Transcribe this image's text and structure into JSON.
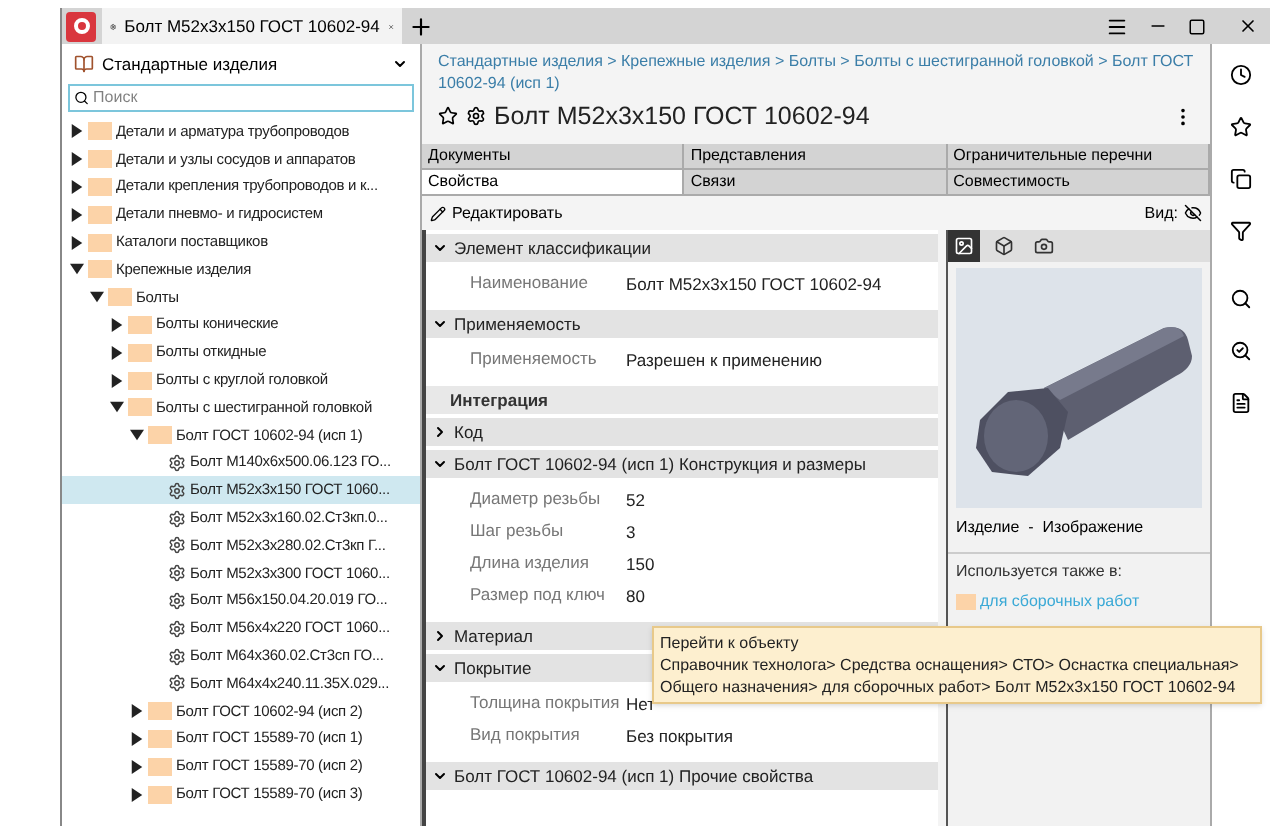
{
  "app": {
    "tab_title": "Болт М52x3x150 ГОСТ 10602-94"
  },
  "library": {
    "name": "Стандартные изделия",
    "search_placeholder": "Поиск"
  },
  "tree": [
    {
      "label": "Детали и арматура трубопроводов",
      "kind": "folder",
      "expanded": false,
      "selected": false
    },
    {
      "label": "Детали и узлы сосудов и аппаратов",
      "kind": "folder",
      "expanded": false,
      "selected": false
    },
    {
      "label": "Детали крепления трубопроводов и к...",
      "kind": "folder",
      "expanded": false,
      "selected": false
    },
    {
      "label": "Детали пневмо- и гидросистем",
      "kind": "folder",
      "expanded": false,
      "selected": false
    },
    {
      "label": "Каталоги поставщиков",
      "kind": "folder",
      "expanded": false,
      "selected": false
    },
    {
      "label": "Крепежные изделия",
      "kind": "folder",
      "expanded": true,
      "selected": false,
      "children": [
        {
          "label": "Болты",
          "kind": "folder",
          "expanded": true,
          "selected": false,
          "children": [
            {
              "label": "Болты конические",
              "kind": "folder",
              "expanded": false,
              "selected": false
            },
            {
              "label": "Болты откидные",
              "kind": "folder",
              "expanded": false,
              "selected": false
            },
            {
              "label": "Болты с круглой головкой",
              "kind": "folder",
              "expanded": false,
              "selected": false
            },
            {
              "label": "Болты с шестигранной головкой",
              "kind": "folder",
              "expanded": true,
              "selected": false,
              "children": [
                {
                  "label": "Болт ГОСТ 10602-94 (исп 1)",
                  "kind": "folder",
                  "expanded": true,
                  "selected": false,
                  "children": [
                    {
                      "label": "Болт М140x6x500.06.123 ГО...",
                      "kind": "item",
                      "selected": false
                    },
                    {
                      "label": "Болт М52x3x150 ГОСТ 1060...",
                      "kind": "item",
                      "selected": true
                    },
                    {
                      "label": "Болт М52x3x160.02.Ст3кп.0...",
                      "kind": "item",
                      "selected": false
                    },
                    {
                      "label": "Болт М52x3x280.02.Ст3кп Г...",
                      "kind": "item",
                      "selected": false
                    },
                    {
                      "label": "Болт М52x3x300 ГОСТ 1060...",
                      "kind": "item",
                      "selected": false
                    },
                    {
                      "label": "Болт М56x150.04.20.019 ГО...",
                      "kind": "item",
                      "selected": false
                    },
                    {
                      "label": "Болт М56x4x220 ГОСТ 1060...",
                      "kind": "item",
                      "selected": false
                    },
                    {
                      "label": "Болт М64x360.02.Ст3сп ГО...",
                      "kind": "item",
                      "selected": false
                    },
                    {
                      "label": "Болт М64x4x240.11.35Х.029...",
                      "kind": "item",
                      "selected": false
                    }
                  ]
                },
                {
                  "label": "Болт ГОСТ 10602-94 (исп 2)",
                  "kind": "folder",
                  "expanded": false,
                  "selected": false
                },
                {
                  "label": "Болт ГОСТ 15589-70 (исп 1)",
                  "kind": "folder",
                  "expanded": false,
                  "selected": false
                },
                {
                  "label": "Болт ГОСТ 15589-70 (исп 2)",
                  "kind": "folder",
                  "expanded": false,
                  "selected": false
                },
                {
                  "label": "Болт ГОСТ 15589-70 (исп 3)",
                  "kind": "folder",
                  "expanded": false,
                  "selected": false
                }
              ]
            }
          ]
        }
      ]
    }
  ],
  "breadcrumb": "Стандартные изделия > Крепежные изделия > Болты > Болты с шестигранной головкой > Болт ГОСТ 10602-94 (исп 1)",
  "title": "Болт М52x3x150 ГОСТ 10602-94",
  "tab_rows": [
    {
      "tabs": [
        {
          "label": "Документы",
          "selected": false
        },
        {
          "label": "Представления",
          "selected": false
        },
        {
          "label": "Ограничительные перечни",
          "selected": false
        }
      ]
    },
    {
      "tabs": [
        {
          "label": "Свойства",
          "selected": true
        },
        {
          "label": "Связи",
          "selected": false
        },
        {
          "label": "Совместимость",
          "selected": false
        }
      ]
    }
  ],
  "toolbar": {
    "edit": "Редактировать",
    "view_label": "Вид:"
  },
  "sections": [
    {
      "kind": "section",
      "title": "Элемент классификации",
      "expanded": true,
      "rows": [
        {
          "label": "Наименование",
          "value": "Болт М52x3x150 ГОСТ 10602-94"
        }
      ]
    },
    {
      "kind": "section",
      "title": "Применяемость",
      "expanded": true,
      "rows": [
        {
          "label": "Применяемость",
          "value": "Разрешен к применению"
        }
      ]
    },
    {
      "kind": "group",
      "title": "Интеграция"
    },
    {
      "kind": "section",
      "title": "Код",
      "expanded": false
    },
    {
      "kind": "section",
      "title": "Болт ГОСТ 10602-94 (исп 1) Конструкция и размеры",
      "expanded": true,
      "rows": [
        {
          "label": "Диаметр резьбы",
          "value": "52"
        },
        {
          "label": "Шаг резьбы",
          "value": "3"
        },
        {
          "label": "Длина изделия",
          "value": "150"
        },
        {
          "label": "Размер под ключ",
          "value": "80"
        }
      ]
    },
    {
      "kind": "section",
      "title": "Материал",
      "expanded": false
    },
    {
      "kind": "section",
      "title": "Покрытие",
      "expanded": true,
      "rows": [
        {
          "label": "Толщина покрытия",
          "value": "Нет"
        },
        {
          "label": "Вид покрытия",
          "value": "Без покрытия"
        }
      ]
    },
    {
      "kind": "section",
      "title": "Болт ГОСТ 10602-94 (исп 1) Прочие свойства",
      "expanded": true
    }
  ],
  "preview": {
    "tools": [
      {
        "kind": "image",
        "selected": true
      },
      {
        "kind": "model",
        "selected": false
      },
      {
        "kind": "camera",
        "selected": false
      }
    ],
    "caption": "Изделие  -  Изображение",
    "used_in_label": "Используется также в:",
    "used_in": [
      {
        "label": "для сборочных работ"
      }
    ]
  },
  "tooltip": {
    "title": "Перейти к объекту",
    "text": "Справочник технолога> Средства оснащения> СТО> Оснастка специальная> Общего назначения> для сборочных работ> Болт М52x3x150 ГОСТ 10602-94"
  }
}
